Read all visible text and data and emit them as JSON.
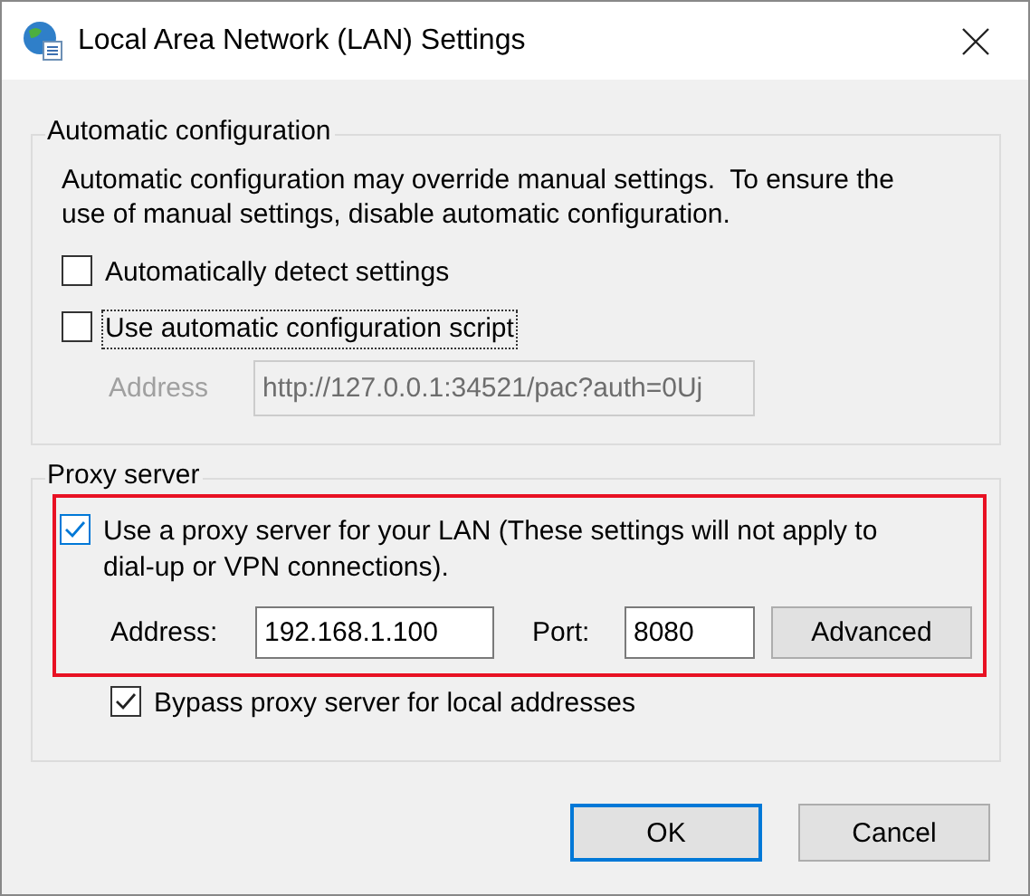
{
  "window": {
    "title": "Local Area Network (LAN) Settings"
  },
  "automatic_configuration": {
    "title": "Automatic configuration",
    "description": "Automatic configuration may override manual settings.  To ensure the use of manual settings, disable automatic configuration.",
    "options": [
      {
        "label": "Automatically detect settings",
        "checked": false,
        "focused": false
      },
      {
        "label": "Use automatic configuration script",
        "checked": false,
        "focused": true
      }
    ],
    "address": {
      "label": "Address",
      "value": "http://127.0.0.1:34521/pac?auth=0Uj",
      "disabled": true
    }
  },
  "proxy_server": {
    "title": "Proxy server",
    "use_proxy": {
      "label": "Use a proxy server for your LAN (These settings will not apply to dial-up or VPN connections).",
      "checked": true,
      "hovered": true,
      "highlighted": true
    },
    "address": {
      "label": "Address:",
      "value": "192.168.1.100"
    },
    "port": {
      "label": "Port:",
      "value": "8080"
    },
    "advanced_button": "Advanced",
    "bypass": {
      "label": "Bypass proxy server for local addresses",
      "checked": true
    }
  },
  "buttons": [
    {
      "label": "OK",
      "default": true
    },
    {
      "label": "Cancel",
      "default": false
    }
  ]
}
